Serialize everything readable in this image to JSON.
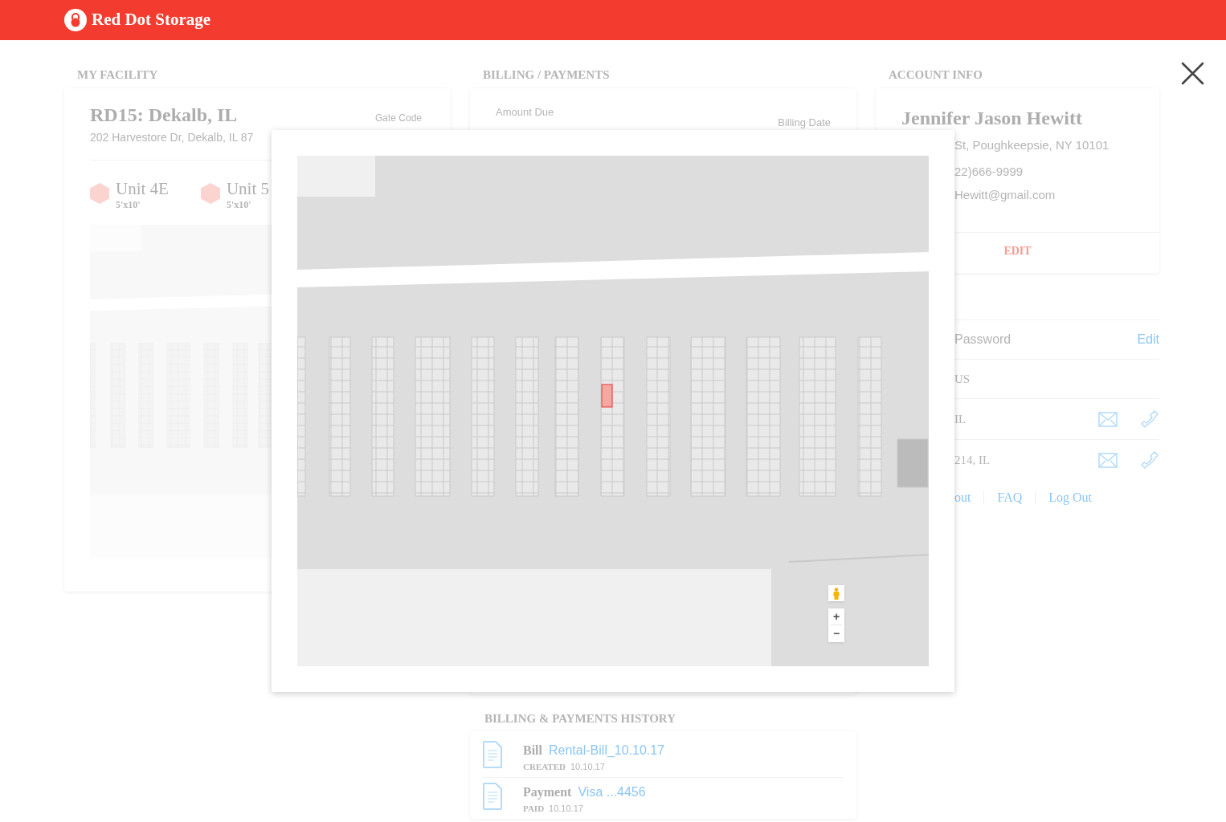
{
  "header": {
    "brand": "Red Dot Storage"
  },
  "my_facility": {
    "heading": "MY FACILITY",
    "facility_name": "RD15: Dekalb, IL",
    "address": "202 Harvestore Dr, Dekalb, IL 87",
    "gate_code_label": "Gate Code",
    "units": [
      {
        "name": "Unit 4E",
        "size": "5'x10'"
      },
      {
        "name": "Unit 5",
        "size": "5'x10'"
      }
    ]
  },
  "billing": {
    "heading": "BILLING / PAYMENTS",
    "amount_due_label": "Amount Due",
    "billing_date_label": "Billing Date"
  },
  "account_info": {
    "heading": "ACCOUNT INFO",
    "name": "Jennifer Jason Hewitt",
    "address": "St, Poughkeepsie, NY 10101",
    "phone": "22)666-9999",
    "email": "Hewitt@gmail.com",
    "edit_button": "EDIT",
    "password_label": "Password",
    "password_edit": "Edit",
    "contacts_heading": "US",
    "contacts": [
      {
        "location": "IL"
      },
      {
        "location": "214, IL"
      }
    ],
    "links": [
      "out",
      "FAQ",
      "Log Out"
    ]
  },
  "history": {
    "heading": "BILLING & PAYMENTS HISTORY",
    "items": [
      {
        "type": "Bill",
        "link": "Rental-Bill_10.10.17",
        "status_label": "CREATED",
        "date": "10.10.17"
      },
      {
        "type": "Payment",
        "link": "Visa ...4456",
        "status_label": "PAID",
        "date": "10.10.17"
      }
    ]
  },
  "modal": {
    "zoom_in": "+",
    "zoom_out": "−"
  }
}
